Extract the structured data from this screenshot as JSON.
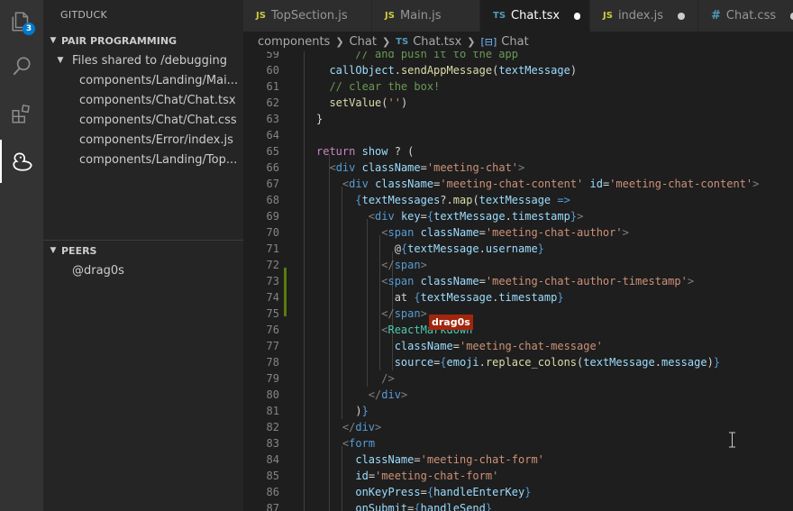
{
  "activity_bar": {
    "explorer_badge": "3",
    "icons": [
      "files-icon",
      "search-icon",
      "extensions-icon",
      "gitduck-icon"
    ]
  },
  "sidebar": {
    "title": "GITDUCK",
    "pair_section": {
      "header": "PAIR PROGRAMMING",
      "folder": "Files shared to /debugging",
      "files": [
        "components/Landing/Mai...",
        "components/Chat/Chat.tsx",
        "components/Chat/Chat.css",
        "components/Error/index.js",
        "components/Landing/Top..."
      ]
    },
    "peers_section": {
      "header": "PEERS",
      "peers": [
        "@drag0s"
      ]
    }
  },
  "tabs": [
    {
      "lang": "JS",
      "label": "TopSection.js",
      "active": false,
      "dirty": false
    },
    {
      "lang": "JS",
      "label": "Main.js",
      "active": false,
      "dirty": false
    },
    {
      "lang": "TS",
      "label": "Chat.tsx",
      "active": true,
      "dirty": true
    },
    {
      "lang": "JS",
      "label": "index.js",
      "active": false,
      "dirty": true
    },
    {
      "lang": "#",
      "label": "Chat.css",
      "active": false,
      "dirty": true
    }
  ],
  "breadcrumb": {
    "folder1": "components",
    "folder2": "Chat",
    "file_lang": "TS",
    "file": "Chat.tsx",
    "symbol": "Chat"
  },
  "editor": {
    "first_line": 59,
    "line_numbers": [
      "59",
      "60",
      "61",
      "62",
      "63",
      "64",
      "65",
      "66",
      "67",
      "68",
      "69",
      "70",
      "71",
      "72",
      "73",
      "74",
      "75",
      "76",
      "77",
      "78",
      "79",
      "80",
      "81",
      "82",
      "83",
      "84",
      "85",
      "86",
      "87"
    ],
    "peer_cursor_label": "drag0s",
    "colors": {
      "modified_gutter": "#587c0c",
      "peer_label_bg": "#a1260d"
    }
  }
}
